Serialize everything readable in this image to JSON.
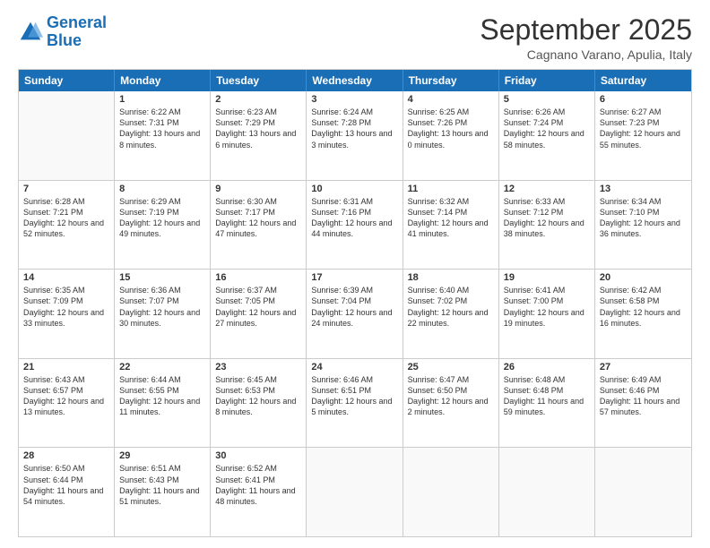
{
  "header": {
    "logo_general": "General",
    "logo_blue": "Blue",
    "title": "September 2025",
    "subtitle": "Cagnano Varano, Apulia, Italy"
  },
  "calendar": {
    "days": [
      "Sunday",
      "Monday",
      "Tuesday",
      "Wednesday",
      "Thursday",
      "Friday",
      "Saturday"
    ],
    "rows": [
      [
        {
          "day": "",
          "empty": true
        },
        {
          "day": "1",
          "sunrise": "Sunrise: 6:22 AM",
          "sunset": "Sunset: 7:31 PM",
          "daylight": "Daylight: 13 hours and 8 minutes."
        },
        {
          "day": "2",
          "sunrise": "Sunrise: 6:23 AM",
          "sunset": "Sunset: 7:29 PM",
          "daylight": "Daylight: 13 hours and 6 minutes."
        },
        {
          "day": "3",
          "sunrise": "Sunrise: 6:24 AM",
          "sunset": "Sunset: 7:28 PM",
          "daylight": "Daylight: 13 hours and 3 minutes."
        },
        {
          "day": "4",
          "sunrise": "Sunrise: 6:25 AM",
          "sunset": "Sunset: 7:26 PM",
          "daylight": "Daylight: 13 hours and 0 minutes."
        },
        {
          "day": "5",
          "sunrise": "Sunrise: 6:26 AM",
          "sunset": "Sunset: 7:24 PM",
          "daylight": "Daylight: 12 hours and 58 minutes."
        },
        {
          "day": "6",
          "sunrise": "Sunrise: 6:27 AM",
          "sunset": "Sunset: 7:23 PM",
          "daylight": "Daylight: 12 hours and 55 minutes."
        }
      ],
      [
        {
          "day": "7",
          "sunrise": "Sunrise: 6:28 AM",
          "sunset": "Sunset: 7:21 PM",
          "daylight": "Daylight: 12 hours and 52 minutes."
        },
        {
          "day": "8",
          "sunrise": "Sunrise: 6:29 AM",
          "sunset": "Sunset: 7:19 PM",
          "daylight": "Daylight: 12 hours and 49 minutes."
        },
        {
          "day": "9",
          "sunrise": "Sunrise: 6:30 AM",
          "sunset": "Sunset: 7:17 PM",
          "daylight": "Daylight: 12 hours and 47 minutes."
        },
        {
          "day": "10",
          "sunrise": "Sunrise: 6:31 AM",
          "sunset": "Sunset: 7:16 PM",
          "daylight": "Daylight: 12 hours and 44 minutes."
        },
        {
          "day": "11",
          "sunrise": "Sunrise: 6:32 AM",
          "sunset": "Sunset: 7:14 PM",
          "daylight": "Daylight: 12 hours and 41 minutes."
        },
        {
          "day": "12",
          "sunrise": "Sunrise: 6:33 AM",
          "sunset": "Sunset: 7:12 PM",
          "daylight": "Daylight: 12 hours and 38 minutes."
        },
        {
          "day": "13",
          "sunrise": "Sunrise: 6:34 AM",
          "sunset": "Sunset: 7:10 PM",
          "daylight": "Daylight: 12 hours and 36 minutes."
        }
      ],
      [
        {
          "day": "14",
          "sunrise": "Sunrise: 6:35 AM",
          "sunset": "Sunset: 7:09 PM",
          "daylight": "Daylight: 12 hours and 33 minutes."
        },
        {
          "day": "15",
          "sunrise": "Sunrise: 6:36 AM",
          "sunset": "Sunset: 7:07 PM",
          "daylight": "Daylight: 12 hours and 30 minutes."
        },
        {
          "day": "16",
          "sunrise": "Sunrise: 6:37 AM",
          "sunset": "Sunset: 7:05 PM",
          "daylight": "Daylight: 12 hours and 27 minutes."
        },
        {
          "day": "17",
          "sunrise": "Sunrise: 6:39 AM",
          "sunset": "Sunset: 7:04 PM",
          "daylight": "Daylight: 12 hours and 24 minutes."
        },
        {
          "day": "18",
          "sunrise": "Sunrise: 6:40 AM",
          "sunset": "Sunset: 7:02 PM",
          "daylight": "Daylight: 12 hours and 22 minutes."
        },
        {
          "day": "19",
          "sunrise": "Sunrise: 6:41 AM",
          "sunset": "Sunset: 7:00 PM",
          "daylight": "Daylight: 12 hours and 19 minutes."
        },
        {
          "day": "20",
          "sunrise": "Sunrise: 6:42 AM",
          "sunset": "Sunset: 6:58 PM",
          "daylight": "Daylight: 12 hours and 16 minutes."
        }
      ],
      [
        {
          "day": "21",
          "sunrise": "Sunrise: 6:43 AM",
          "sunset": "Sunset: 6:57 PM",
          "daylight": "Daylight: 12 hours and 13 minutes."
        },
        {
          "day": "22",
          "sunrise": "Sunrise: 6:44 AM",
          "sunset": "Sunset: 6:55 PM",
          "daylight": "Daylight: 12 hours and 11 minutes."
        },
        {
          "day": "23",
          "sunrise": "Sunrise: 6:45 AM",
          "sunset": "Sunset: 6:53 PM",
          "daylight": "Daylight: 12 hours and 8 minutes."
        },
        {
          "day": "24",
          "sunrise": "Sunrise: 6:46 AM",
          "sunset": "Sunset: 6:51 PM",
          "daylight": "Daylight: 12 hours and 5 minutes."
        },
        {
          "day": "25",
          "sunrise": "Sunrise: 6:47 AM",
          "sunset": "Sunset: 6:50 PM",
          "daylight": "Daylight: 12 hours and 2 minutes."
        },
        {
          "day": "26",
          "sunrise": "Sunrise: 6:48 AM",
          "sunset": "Sunset: 6:48 PM",
          "daylight": "Daylight: 11 hours and 59 minutes."
        },
        {
          "day": "27",
          "sunrise": "Sunrise: 6:49 AM",
          "sunset": "Sunset: 6:46 PM",
          "daylight": "Daylight: 11 hours and 57 minutes."
        }
      ],
      [
        {
          "day": "28",
          "sunrise": "Sunrise: 6:50 AM",
          "sunset": "Sunset: 6:44 PM",
          "daylight": "Daylight: 11 hours and 54 minutes."
        },
        {
          "day": "29",
          "sunrise": "Sunrise: 6:51 AM",
          "sunset": "Sunset: 6:43 PM",
          "daylight": "Daylight: 11 hours and 51 minutes."
        },
        {
          "day": "30",
          "sunrise": "Sunrise: 6:52 AM",
          "sunset": "Sunset: 6:41 PM",
          "daylight": "Daylight: 11 hours and 48 minutes."
        },
        {
          "day": "",
          "empty": true
        },
        {
          "day": "",
          "empty": true
        },
        {
          "day": "",
          "empty": true
        },
        {
          "day": "",
          "empty": true
        }
      ]
    ]
  }
}
